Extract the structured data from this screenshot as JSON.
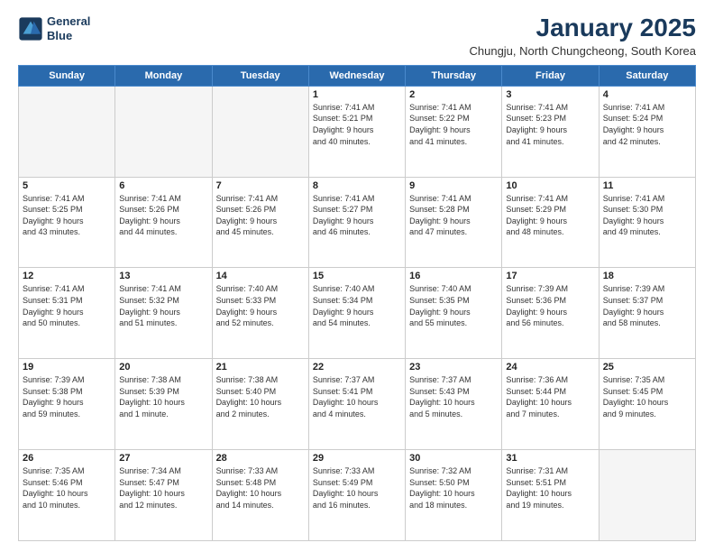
{
  "logo": {
    "line1": "General",
    "line2": "Blue"
  },
  "title": "January 2025",
  "subtitle": "Chungju, North Chungcheong, South Korea",
  "days_header": [
    "Sunday",
    "Monday",
    "Tuesday",
    "Wednesday",
    "Thursday",
    "Friday",
    "Saturday"
  ],
  "weeks": [
    [
      {
        "day": "",
        "info": ""
      },
      {
        "day": "",
        "info": ""
      },
      {
        "day": "",
        "info": ""
      },
      {
        "day": "1",
        "info": "Sunrise: 7:41 AM\nSunset: 5:21 PM\nDaylight: 9 hours\nand 40 minutes."
      },
      {
        "day": "2",
        "info": "Sunrise: 7:41 AM\nSunset: 5:22 PM\nDaylight: 9 hours\nand 41 minutes."
      },
      {
        "day": "3",
        "info": "Sunrise: 7:41 AM\nSunset: 5:23 PM\nDaylight: 9 hours\nand 41 minutes."
      },
      {
        "day": "4",
        "info": "Sunrise: 7:41 AM\nSunset: 5:24 PM\nDaylight: 9 hours\nand 42 minutes."
      }
    ],
    [
      {
        "day": "5",
        "info": "Sunrise: 7:41 AM\nSunset: 5:25 PM\nDaylight: 9 hours\nand 43 minutes."
      },
      {
        "day": "6",
        "info": "Sunrise: 7:41 AM\nSunset: 5:26 PM\nDaylight: 9 hours\nand 44 minutes."
      },
      {
        "day": "7",
        "info": "Sunrise: 7:41 AM\nSunset: 5:26 PM\nDaylight: 9 hours\nand 45 minutes."
      },
      {
        "day": "8",
        "info": "Sunrise: 7:41 AM\nSunset: 5:27 PM\nDaylight: 9 hours\nand 46 minutes."
      },
      {
        "day": "9",
        "info": "Sunrise: 7:41 AM\nSunset: 5:28 PM\nDaylight: 9 hours\nand 47 minutes."
      },
      {
        "day": "10",
        "info": "Sunrise: 7:41 AM\nSunset: 5:29 PM\nDaylight: 9 hours\nand 48 minutes."
      },
      {
        "day": "11",
        "info": "Sunrise: 7:41 AM\nSunset: 5:30 PM\nDaylight: 9 hours\nand 49 minutes."
      }
    ],
    [
      {
        "day": "12",
        "info": "Sunrise: 7:41 AM\nSunset: 5:31 PM\nDaylight: 9 hours\nand 50 minutes."
      },
      {
        "day": "13",
        "info": "Sunrise: 7:41 AM\nSunset: 5:32 PM\nDaylight: 9 hours\nand 51 minutes."
      },
      {
        "day": "14",
        "info": "Sunrise: 7:40 AM\nSunset: 5:33 PM\nDaylight: 9 hours\nand 52 minutes."
      },
      {
        "day": "15",
        "info": "Sunrise: 7:40 AM\nSunset: 5:34 PM\nDaylight: 9 hours\nand 54 minutes."
      },
      {
        "day": "16",
        "info": "Sunrise: 7:40 AM\nSunset: 5:35 PM\nDaylight: 9 hours\nand 55 minutes."
      },
      {
        "day": "17",
        "info": "Sunrise: 7:39 AM\nSunset: 5:36 PM\nDaylight: 9 hours\nand 56 minutes."
      },
      {
        "day": "18",
        "info": "Sunrise: 7:39 AM\nSunset: 5:37 PM\nDaylight: 9 hours\nand 58 minutes."
      }
    ],
    [
      {
        "day": "19",
        "info": "Sunrise: 7:39 AM\nSunset: 5:38 PM\nDaylight: 9 hours\nand 59 minutes."
      },
      {
        "day": "20",
        "info": "Sunrise: 7:38 AM\nSunset: 5:39 PM\nDaylight: 10 hours\nand 1 minute."
      },
      {
        "day": "21",
        "info": "Sunrise: 7:38 AM\nSunset: 5:40 PM\nDaylight: 10 hours\nand 2 minutes."
      },
      {
        "day": "22",
        "info": "Sunrise: 7:37 AM\nSunset: 5:41 PM\nDaylight: 10 hours\nand 4 minutes."
      },
      {
        "day": "23",
        "info": "Sunrise: 7:37 AM\nSunset: 5:43 PM\nDaylight: 10 hours\nand 5 minutes."
      },
      {
        "day": "24",
        "info": "Sunrise: 7:36 AM\nSunset: 5:44 PM\nDaylight: 10 hours\nand 7 minutes."
      },
      {
        "day": "25",
        "info": "Sunrise: 7:35 AM\nSunset: 5:45 PM\nDaylight: 10 hours\nand 9 minutes."
      }
    ],
    [
      {
        "day": "26",
        "info": "Sunrise: 7:35 AM\nSunset: 5:46 PM\nDaylight: 10 hours\nand 10 minutes."
      },
      {
        "day": "27",
        "info": "Sunrise: 7:34 AM\nSunset: 5:47 PM\nDaylight: 10 hours\nand 12 minutes."
      },
      {
        "day": "28",
        "info": "Sunrise: 7:33 AM\nSunset: 5:48 PM\nDaylight: 10 hours\nand 14 minutes."
      },
      {
        "day": "29",
        "info": "Sunrise: 7:33 AM\nSunset: 5:49 PM\nDaylight: 10 hours\nand 16 minutes."
      },
      {
        "day": "30",
        "info": "Sunrise: 7:32 AM\nSunset: 5:50 PM\nDaylight: 10 hours\nand 18 minutes."
      },
      {
        "day": "31",
        "info": "Sunrise: 7:31 AM\nSunset: 5:51 PM\nDaylight: 10 hours\nand 19 minutes."
      },
      {
        "day": "",
        "info": ""
      }
    ]
  ]
}
